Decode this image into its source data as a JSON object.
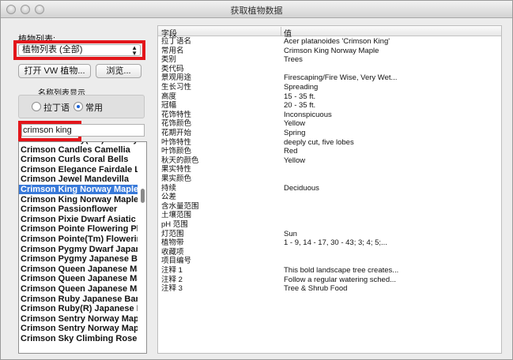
{
  "window": {
    "title": "获取植物数据"
  },
  "left": {
    "plant_list_label": "植物列表:",
    "plant_list_selected": "植物列表 (全部)",
    "open_button": "打开 VW 植物...",
    "browse_button": "浏览...",
    "display_label": "名称列表显示",
    "radio_latin": "拉丁语",
    "radio_common": "常用",
    "search_value": "crimson king",
    "items": [
      "Crimson Sentry(Tm) Norway",
      "Crimson Candles Camellia",
      "Crimson Curls Coral Bells",
      "Crimson Elegance Fairdale Lil",
      "Crimson Jewel Mandevilla",
      "Crimson King Norway Maple",
      "Crimson King Norway Maple",
      "Crimson Passionflower",
      "Crimson Pixie Dwarf Asiatic Li",
      "Crimson Pointe Flowering Plu",
      "Crimson Pointe(Tm) Flowerin",
      "Crimson Pygmy Dwarf Japane",
      "Crimson Pygmy Japanese Bar",
      "Crimson Queen Japanese Map",
      "Crimson Queen Japanese Map",
      "Crimson Queen Japanese Map",
      "Crimson Ruby Japanese Barbe",
      "Crimson Ruby(R) Japanese Bar",
      "Crimson Sentry Norway Maple",
      "Crimson Sentry Norway Maple",
      "Crimson Sky Climbing Rose"
    ],
    "selected_index": 5
  },
  "table": {
    "header_field": "字段",
    "header_value": "值",
    "rows": [
      {
        "field": "拉丁语名",
        "value": "Acer platanoides 'Crimson King'"
      },
      {
        "field": "常用名",
        "value": "Crimson King Norway Maple"
      },
      {
        "field": "类别",
        "value": "Trees"
      },
      {
        "field": "类代码",
        "value": ""
      },
      {
        "field": "景观用途",
        "value": "Firescaping/Fire Wise, Very Wet..."
      },
      {
        "field": "生长习性",
        "value": "Spreading"
      },
      {
        "field": "高度",
        "value": "15 - 35 ft."
      },
      {
        "field": "冠幅",
        "value": "20 - 35 ft."
      },
      {
        "field": "花饰特性",
        "value": "Inconspicuous"
      },
      {
        "field": "花饰颜色",
        "value": "Yellow"
      },
      {
        "field": "花期开始",
        "value": "Spring"
      },
      {
        "field": "叶饰特性",
        "value": "deeply cut, five lobes"
      },
      {
        "field": "叶饰颜色",
        "value": "Red"
      },
      {
        "field": "秋天的颜色",
        "value": "Yellow"
      },
      {
        "field": "果实特性",
        "value": ""
      },
      {
        "field": "果实颜色",
        "value": ""
      },
      {
        "field": "持续",
        "value": "Deciduous"
      },
      {
        "field": "公差",
        "value": ""
      },
      {
        "field": "含水量范围",
        "value": ""
      },
      {
        "field": "土壤范围",
        "value": ""
      },
      {
        "field": "pH 范围",
        "value": ""
      },
      {
        "field": "灯范围",
        "value": "Sun"
      },
      {
        "field": "植物带",
        "value": "1 - 9, 14 - 17, 30 - 43; 3; 4; 5;..."
      },
      {
        "field": "收藏项",
        "value": ""
      },
      {
        "field": "项目编号",
        "value": ""
      },
      {
        "field": "注释 1",
        "value": "This bold landscape tree creates..."
      },
      {
        "field": "注释 2",
        "value": "Follow a regular watering sched..."
      },
      {
        "field": "注释 3",
        "value": "Tree & Shrub Food"
      }
    ]
  },
  "colors": {
    "highlight": "#e3161b",
    "selection": "#3879d9"
  }
}
